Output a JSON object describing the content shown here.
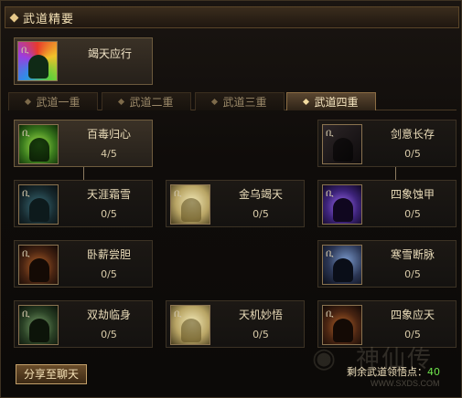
{
  "header": {
    "title": "武道精要"
  },
  "top_skill": {
    "name": "竭天应行",
    "icon": "warrior-green-icon"
  },
  "tabs": [
    {
      "label": "武道一重",
      "active": false
    },
    {
      "label": "武道二重",
      "active": false
    },
    {
      "label": "武道三重",
      "active": false
    },
    {
      "label": "武道四重",
      "active": true
    }
  ],
  "skills": [
    {
      "name": "百毒归心",
      "level": "4/5",
      "lit": true,
      "icon": "poison-green-icon"
    },
    {
      "name": "剑意长存",
      "level": "0/5",
      "lit": false,
      "icon": "sword-aura-icon"
    },
    {
      "name": "天涯霜雪",
      "level": "0/5",
      "lit": false,
      "icon": "frost-icon"
    },
    {
      "name": "金乌竭天",
      "level": "0/5",
      "lit": false,
      "icon": "golden-crow-icon"
    },
    {
      "name": "四象蚀甲",
      "level": "0/5",
      "lit": false,
      "icon": "corrode-armor-icon"
    },
    {
      "name": "卧薪尝胆",
      "level": "0/5",
      "lit": false,
      "icon": "endurance-icon"
    },
    {
      "name": "寒雪断脉",
      "level": "0/5",
      "lit": false,
      "icon": "cold-snow-icon"
    },
    {
      "name": "双劫临身",
      "level": "0/5",
      "lit": false,
      "icon": "double-calamity-icon"
    },
    {
      "name": "天机妙悟",
      "level": "0/5",
      "lit": false,
      "icon": "insight-icon"
    },
    {
      "name": "四象应天",
      "level": "0/5",
      "lit": false,
      "icon": "four-symbols-icon"
    }
  ],
  "share_button": "分享至聊天",
  "remaining_points": {
    "label": "剩余武道领悟点：",
    "value": "40"
  },
  "watermark": {
    "text": "神仙传",
    "url": "WWW.SXDS.COM"
  },
  "colors": {
    "accent": "#e7c98a",
    "points_value": "#6ee24c"
  }
}
